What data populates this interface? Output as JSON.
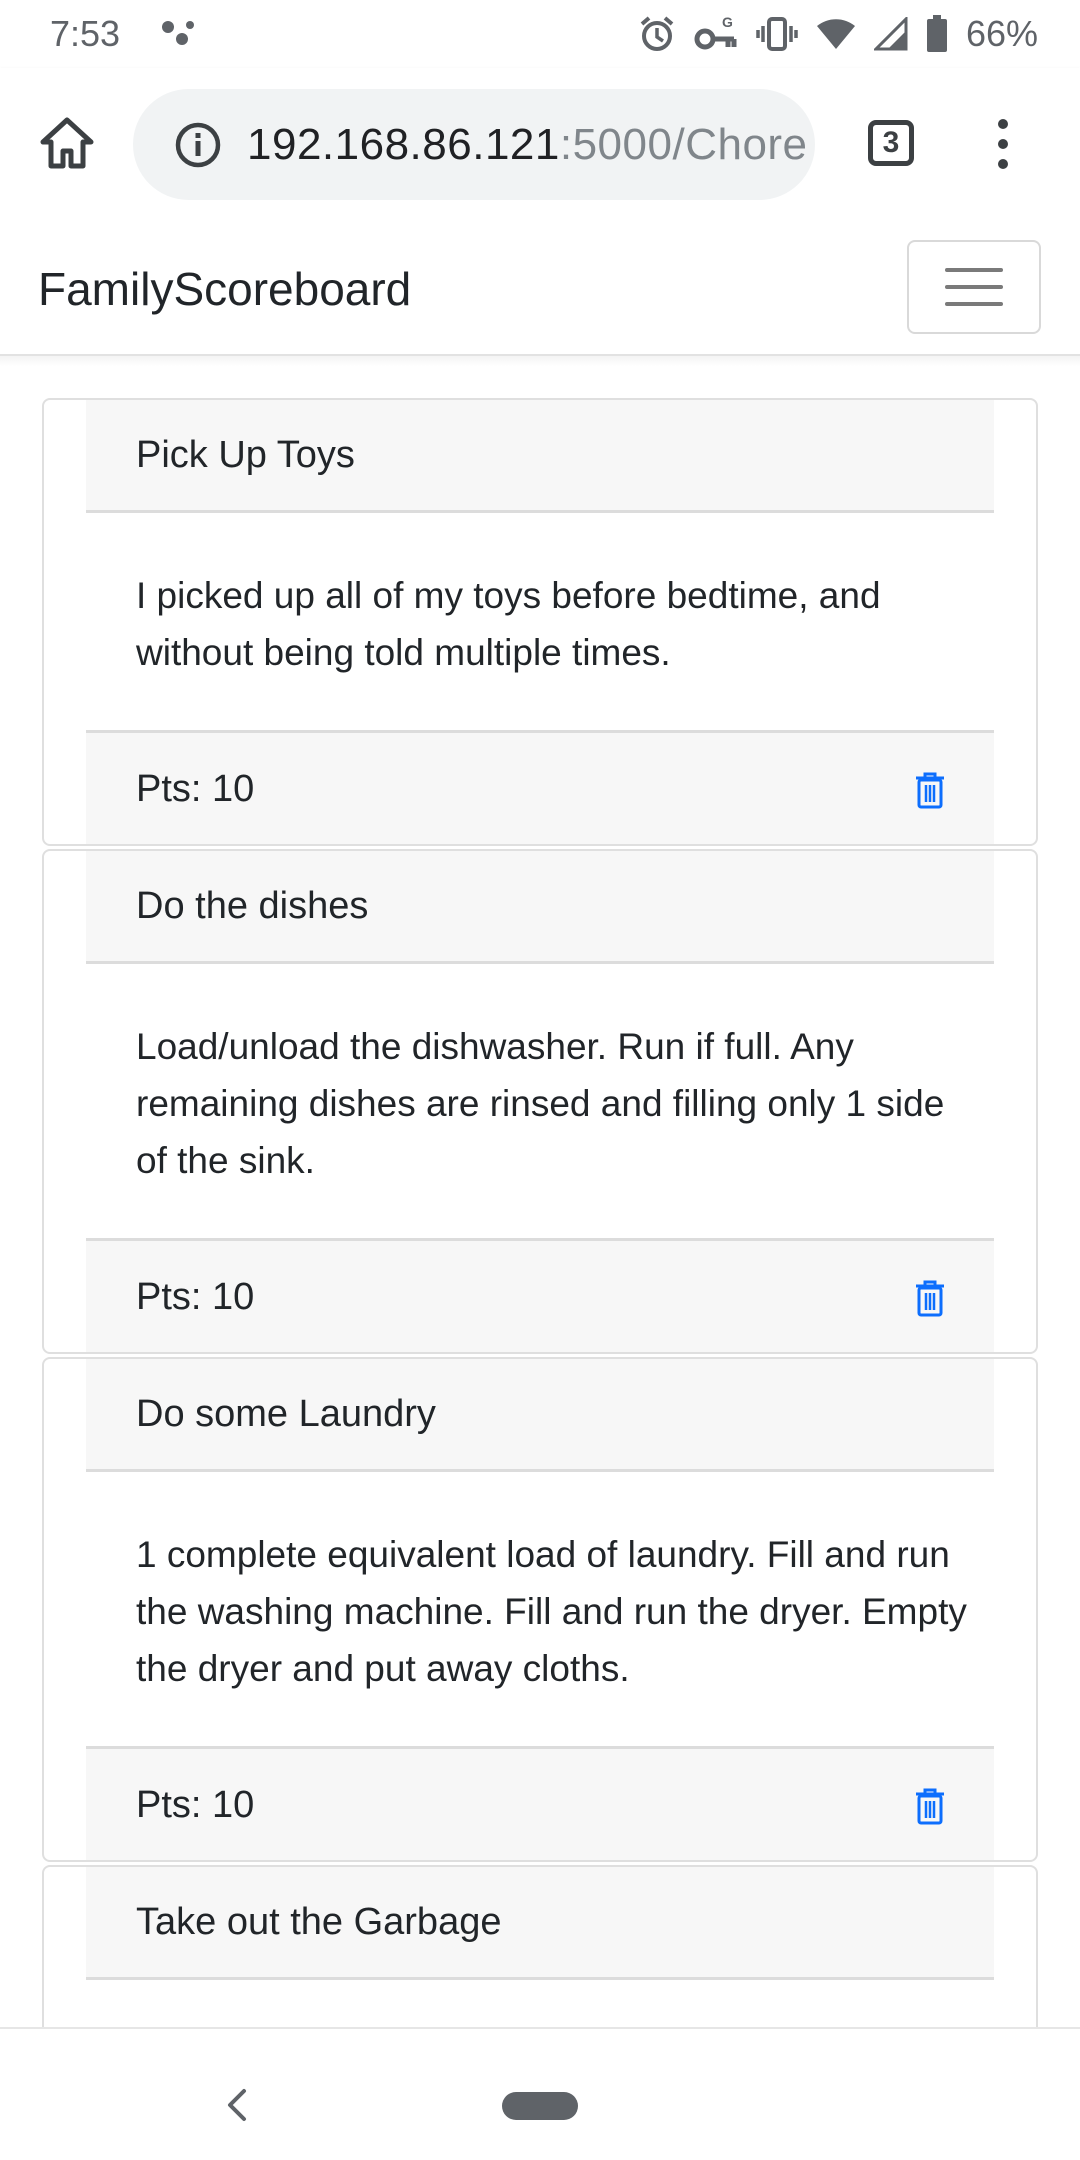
{
  "status_bar": {
    "time": "7:53",
    "battery": "66%",
    "icons": [
      "notification-dots-icon",
      "alarm-icon",
      "vpn-key-icon",
      "vibrate-icon",
      "wifi-icon",
      "signal-icon",
      "battery-icon"
    ]
  },
  "browser": {
    "url_host": "192.168.86.121",
    "url_rest": ":5000/Chore",
    "tab_count": "3"
  },
  "navbar": {
    "brand": "FamilyScoreboard"
  },
  "chores": [
    {
      "title": "Pick Up Toys",
      "description": "I picked up all of my toys before bedtime, and without being told multiple times.",
      "points": "Pts: 10"
    },
    {
      "title": "Do the dishes",
      "description": "Load/unload the dishwasher. Run if full. Any remaining dishes are rinsed and filling only 1 side of the sink.",
      "points": "Pts: 10"
    },
    {
      "title": "Do some Laundry",
      "description": "1 complete equivalent load of laundry. Fill and run the washing machine. Fill and run the dryer. Empty the dryer and put away cloths.",
      "points": "Pts: 10"
    },
    {
      "title": "Take out the Garbage"
    }
  ],
  "colors": {
    "accent": "#0d6efd",
    "card_header_bg": "#f7f7f7"
  }
}
